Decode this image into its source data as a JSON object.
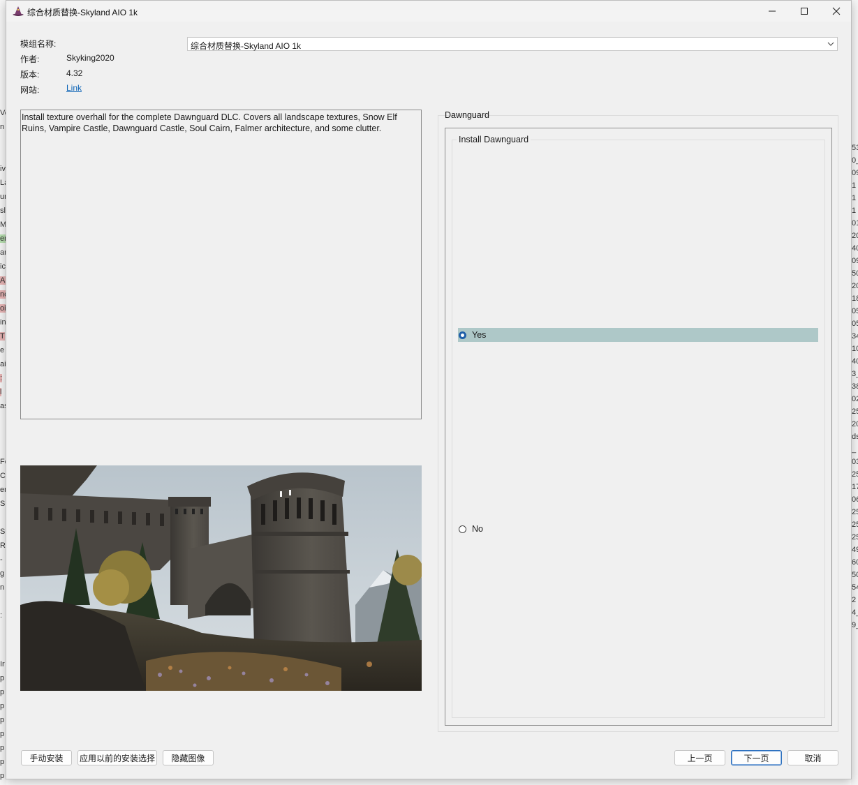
{
  "window": {
    "title": "综合材质替换-Skyland AIO 1k",
    "minimize_icon": "minimize-icon",
    "maximize_icon": "maximize-icon",
    "close_icon": "close-icon"
  },
  "info": {
    "mod_name_label": "模组名称:",
    "author_label": "作者:",
    "author": "Skyking2020",
    "version_label": "版本:",
    "version": "4.32",
    "website_label": "网站:",
    "website_link": "Link"
  },
  "mod_select": {
    "value": "综合材质替换-Skyland AIO 1k"
  },
  "description": "Install texture overhall for the complete Dawnguard DLC. Covers all landscape textures, Snow Elf Ruins, Vampire Castle, Dawnguard Castle, Soul Cairn, Falmer architecture, and some clutter.",
  "group": {
    "title": "Dawnguard",
    "fieldset_title": "Install Dawnguard",
    "options": [
      {
        "label": "Yes",
        "selected": true
      },
      {
        "label": "No",
        "selected": false
      }
    ]
  },
  "buttons": {
    "manual": "手动安装",
    "apply_previous": "应用以前的安装选择",
    "hide_image": "隐藏图像",
    "prev": "上一页",
    "next": "下一页",
    "cancel": "取消"
  },
  "background_left": [
    "Vo",
    "n",
    "iv",
    "La",
    "un",
    "sl",
    "M",
    "er",
    "an",
    "ic",
    "Al",
    "nc",
    "oi",
    "in",
    "T",
    "e",
    "ai",
    ":",
    "l",
    "as",
    "Fe",
    "C",
    "er",
    "Sl",
    "S",
    "R",
    "-",
    "g",
    "n",
    ":",
    "Ir",
    "p",
    "p",
    "p",
    "p",
    "p",
    "p",
    "p",
    "p",
    "p"
  ],
  "background_right": [
    "53",
    "0_",
    "09",
    "1",
    "1",
    "1",
    "01",
    "20",
    "40",
    "09",
    "50",
    "20",
    "18",
    "05",
    "05",
    "34",
    "10",
    "40",
    "3_",
    "38",
    "02",
    "25",
    "20",
    "ds",
    "_",
    "03",
    "25",
    "17",
    "06",
    "25",
    "25",
    "25",
    "49",
    "60",
    "50",
    "54",
    "2",
    "4_",
    "9_"
  ],
  "colors": {
    "accent": "#1f5fa8",
    "selected_row": "#aec8c8",
    "link": "#0b63b6"
  }
}
